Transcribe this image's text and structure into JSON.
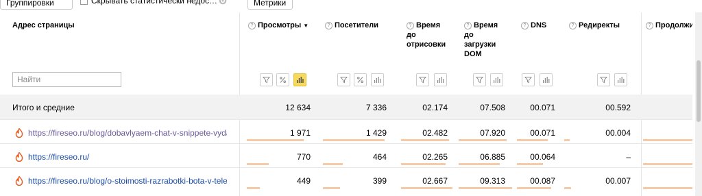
{
  "toolbar": {
    "groupings_label": "Группировки",
    "hide_stats_label": "Скрывать статистически недостоверные данные",
    "metrics_label": "Метрики"
  },
  "table": {
    "header": {
      "address": "Адрес страницы",
      "views": "Просмотры",
      "visitors": "Посетители",
      "render_time": "Время до отрисовки",
      "dom_time": "Время до загрузки DOM",
      "dns": "DNS",
      "redirects": "Редиректы",
      "connection": "Продолжительность установки соединения"
    },
    "search_placeholder": "Найти",
    "totals": {
      "label": "Итого и средние",
      "views": "12 634",
      "visitors": "7 336",
      "render_time": "02.174",
      "dom_time": "07.508",
      "dns": "00.071",
      "redirects": "00.592"
    },
    "rows": [
      {
        "url": "https://fireseo.ru/blog/dobavlyaem-chat-v-snippete-vydachi",
        "views": "1 971",
        "visitors": "1 429",
        "render_time": "02.482",
        "dom_time": "07.920",
        "dns": "00.071",
        "redirects": "00.004",
        "views_share": 0.156,
        "visitors_share": 0.195
      },
      {
        "url": "https://fireseo.ru/",
        "views": "770",
        "visitors": "464",
        "render_time": "02.265",
        "dom_time": "06.885",
        "dns": "00.064",
        "redirects": "–",
        "views_share": 0.061,
        "visitors_share": 0.063
      },
      {
        "url": "https://fireseo.ru/blog/o-stoimosti-razrabotki-bota-v-telegram",
        "views": "449",
        "visitors": "399",
        "render_time": "02.667",
        "dom_time": "09.313",
        "dns": "00.087",
        "redirects": "00.007",
        "views_share": 0.036,
        "visitors_share": 0.054
      }
    ]
  },
  "colors": {
    "active_chart_toggle": "#f6d95c",
    "bar_fill": "#f6c9a7",
    "link": "#1a4ba8",
    "visited_link": "#6a5a9a"
  }
}
